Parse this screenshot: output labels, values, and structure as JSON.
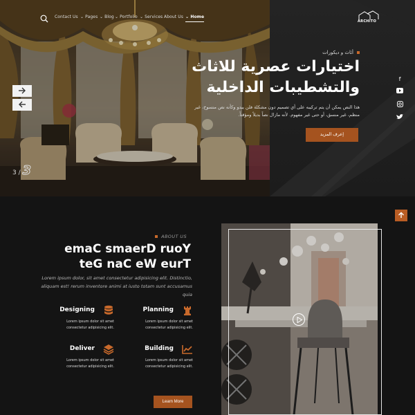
{
  "nav": {
    "links": [
      "Contact Us",
      "Pages",
      "Blog",
      "Portfolio",
      "Services",
      "About Us",
      "Home"
    ],
    "active_link": "Home",
    "logo_text": "ARCHITO"
  },
  "hero": {
    "eyebrow": "أثاث و ديكورات",
    "title": "اختيارات عصرية للاثاث والتشطيبات الداخلية",
    "description": "هذا النص يمكن أن يتم تركيبه على أي تصميم دون مشكلة فلن يبدو وكأنه نص منسوخ، غير منظم، غير منسق، أو حتى غير مفهوم. لأنه مازال نصاً بديلاً ومؤقتاً.",
    "button_label": "إعرف المزيد",
    "slide_current": "3",
    "slide_total": "3"
  },
  "social": [
    "facebook-icon",
    "youtube-icon",
    "instagram-icon",
    "twitter-icon"
  ],
  "about": {
    "eyebrow": "ABOUT US",
    "title": "emaC smaerD ruoY teG naC eW eurT",
    "text": "Lorem ipsum dolor, sit amet consectetur adipisicing elit. Distinctio, aliquam est! rerum inventore animi at iusto totam sunt accusamus quia",
    "features": [
      {
        "title": "Designing",
        "icon": "database-icon",
        "text": "Lorem ipsum dolor sit amet consectetur adipisicing elit."
      },
      {
        "title": "Planning",
        "icon": "chess-rook-icon",
        "text": "Lorem ipsum dolor sit amet consectetur adipisicing elit."
      },
      {
        "title": "Deliver",
        "icon": "layers-icon",
        "text": "Lorem ipsum dolor sit amet consectetur adipisicing elit."
      },
      {
        "title": "Building",
        "icon": "chart-line-icon",
        "text": "Lorem ipsum dolor sit amet consectetur adipisicing elit."
      }
    ],
    "button_label": "Learn More"
  },
  "colors": {
    "accent": "#a5531f",
    "background": "#141414",
    "hero_panel": "#1c1c1c"
  }
}
